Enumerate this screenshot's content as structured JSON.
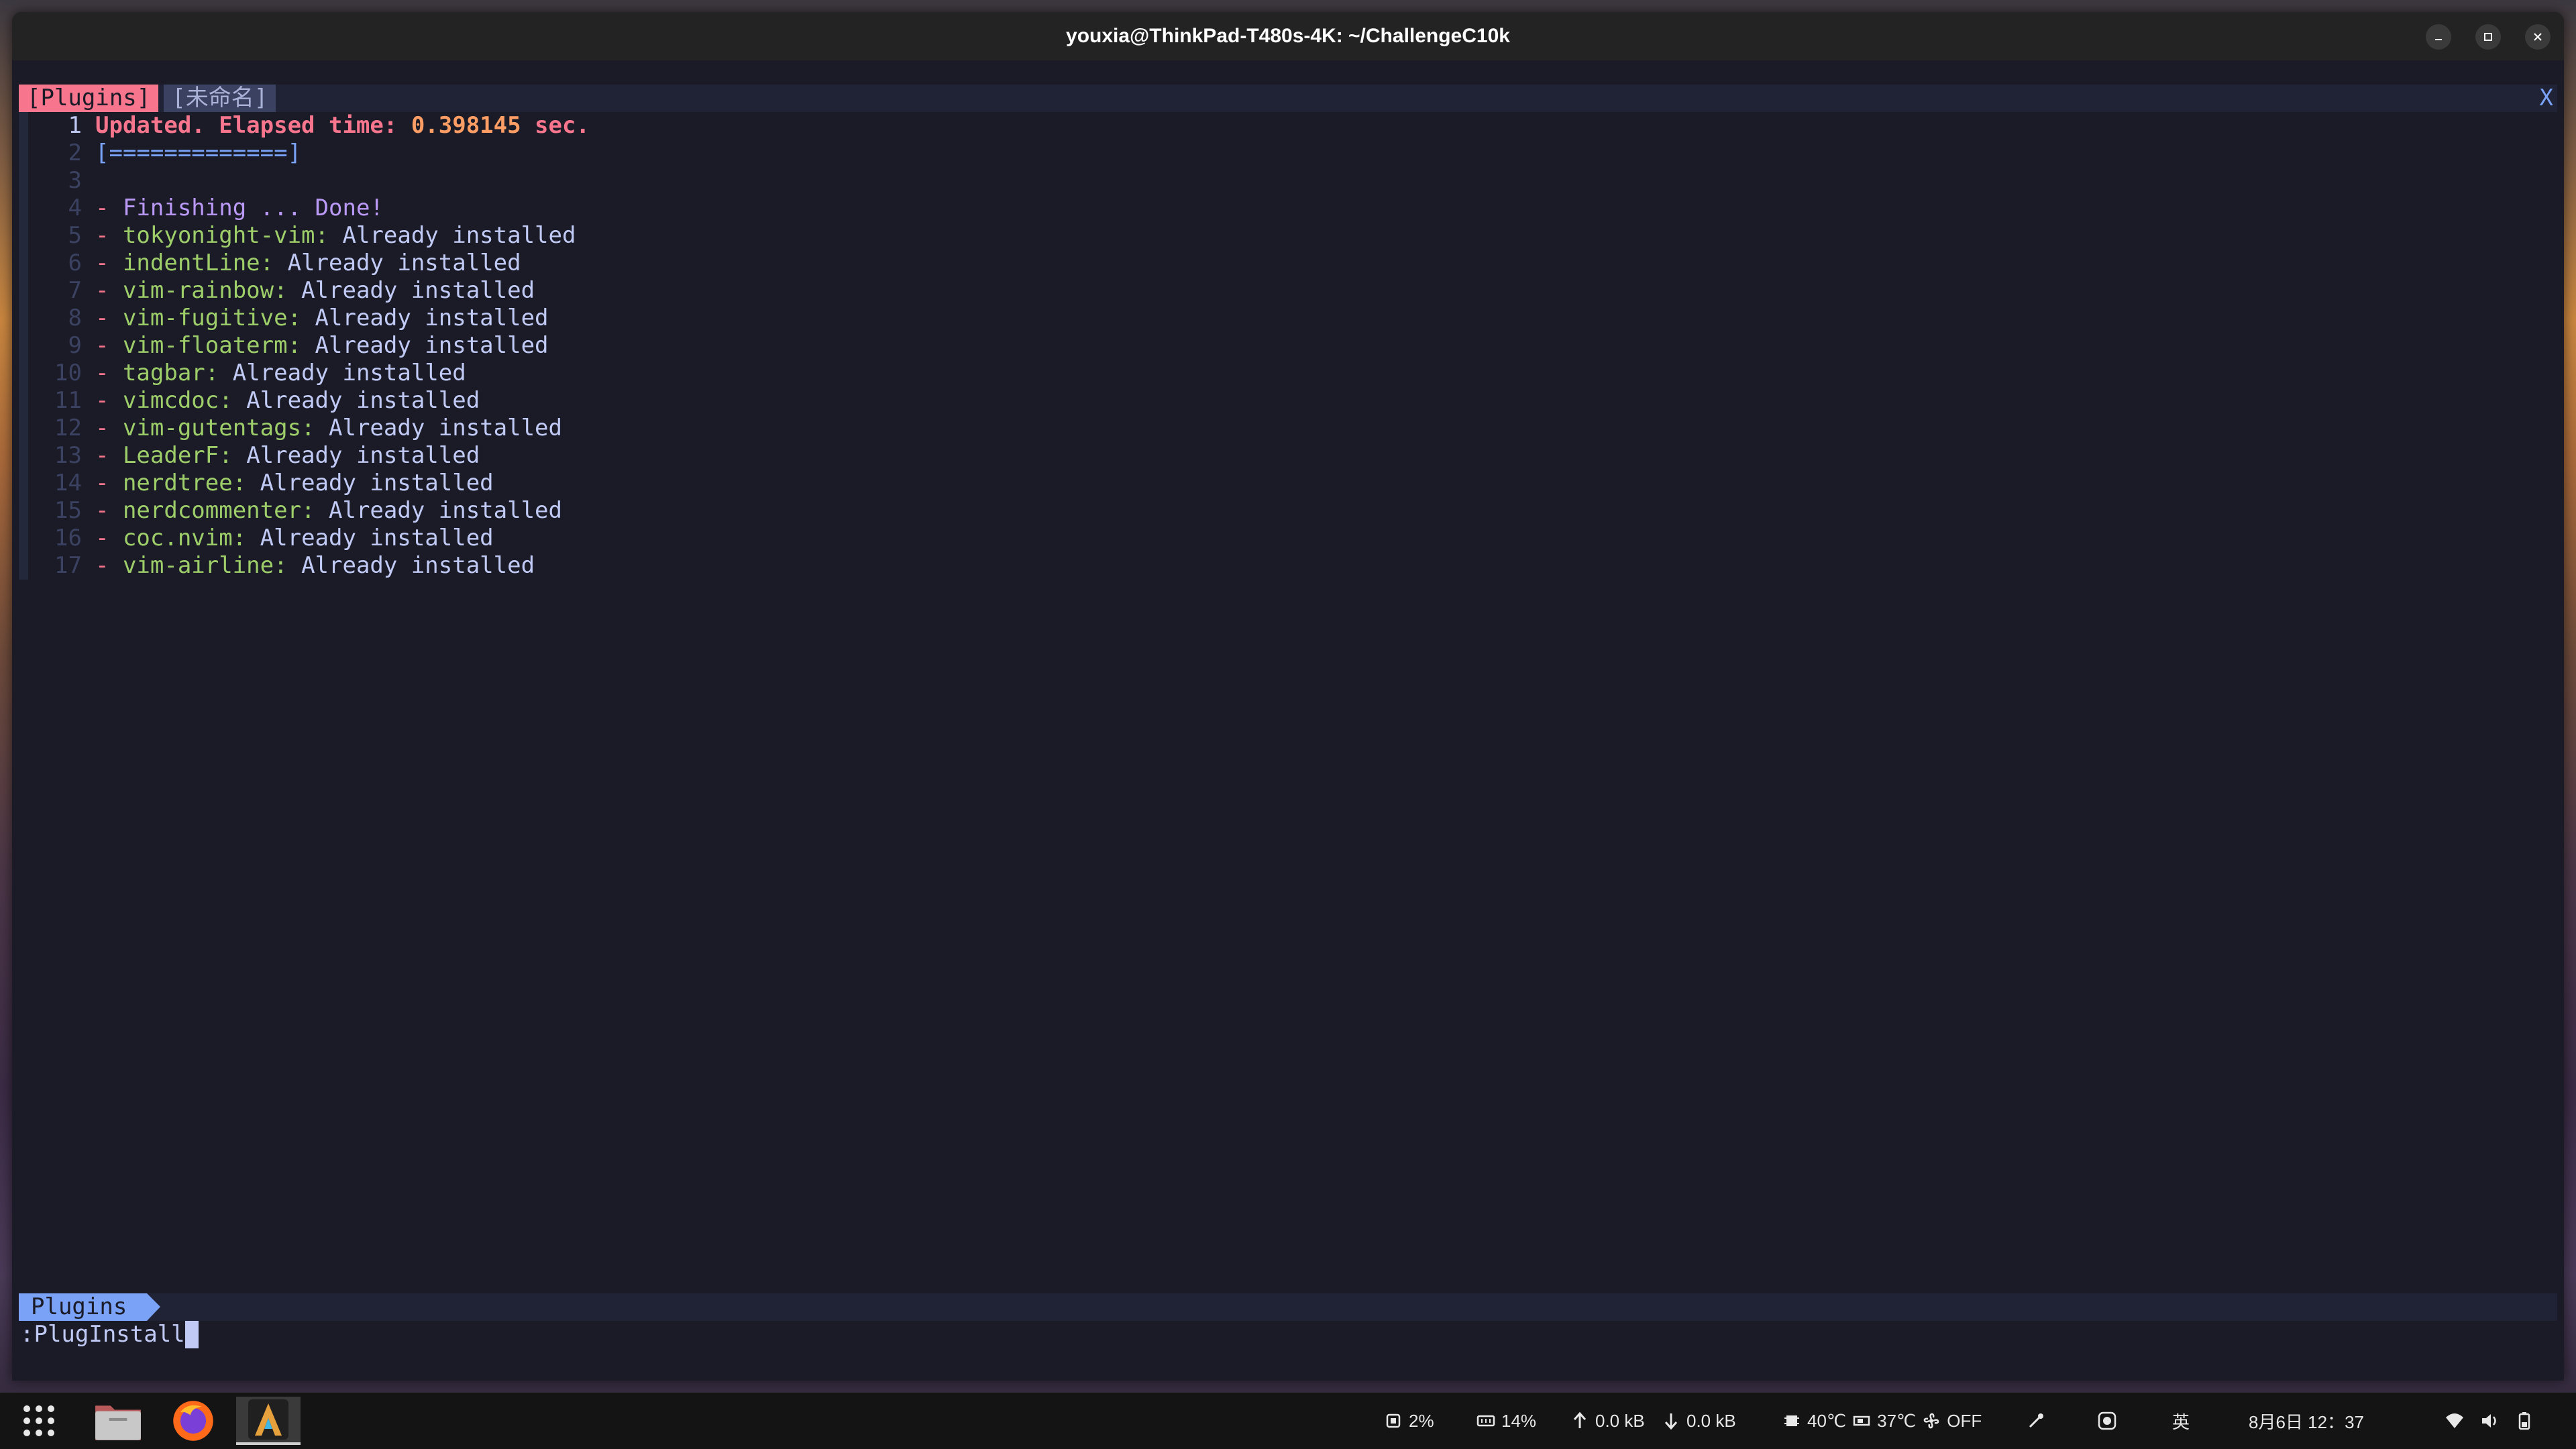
{
  "window": {
    "title": "youxia@ThinkPad-T480s-4K: ~/ChallengeC10k"
  },
  "vim": {
    "tabs": [
      "[Plugins]",
      "[未命名]"
    ],
    "tab_close": "X",
    "lines": [
      {
        "num": "1",
        "parts": [
          {
            "t": "Updated. Elapsed time: ",
            "c": "txt-head"
          },
          {
            "t": "0.398145",
            "c": "txt-time"
          },
          {
            "t": " sec.",
            "c": "txt-head"
          }
        ]
      },
      {
        "num": "2",
        "parts": [
          {
            "t": "[=============]",
            "c": "txt-bar"
          }
        ]
      },
      {
        "num": "3",
        "parts": []
      },
      {
        "num": "4",
        "parts": [
          {
            "t": "- ",
            "c": "dash"
          },
          {
            "t": "Finishing ... Done!",
            "c": "txt-finish"
          }
        ]
      },
      {
        "num": "5",
        "parts": [
          {
            "t": "- ",
            "c": "dash"
          },
          {
            "t": "tokyonight-vim:",
            "c": "pname"
          },
          {
            "t": " Already installed",
            "c": "pstat"
          }
        ]
      },
      {
        "num": "6",
        "parts": [
          {
            "t": "- ",
            "c": "dash"
          },
          {
            "t": "indentLine:",
            "c": "pname"
          },
          {
            "t": " Already installed",
            "c": "pstat"
          }
        ]
      },
      {
        "num": "7",
        "parts": [
          {
            "t": "- ",
            "c": "dash"
          },
          {
            "t": "vim-rainbow:",
            "c": "pname"
          },
          {
            "t": " Already installed",
            "c": "pstat"
          }
        ]
      },
      {
        "num": "8",
        "parts": [
          {
            "t": "- ",
            "c": "dash"
          },
          {
            "t": "vim-fugitive:",
            "c": "pname"
          },
          {
            "t": " Already installed",
            "c": "pstat"
          }
        ]
      },
      {
        "num": "9",
        "parts": [
          {
            "t": "- ",
            "c": "dash"
          },
          {
            "t": "vim-floaterm:",
            "c": "pname"
          },
          {
            "t": " Already installed",
            "c": "pstat"
          }
        ]
      },
      {
        "num": "10",
        "parts": [
          {
            "t": "- ",
            "c": "dash"
          },
          {
            "t": "tagbar:",
            "c": "pname"
          },
          {
            "t": " Already installed",
            "c": "pstat"
          }
        ]
      },
      {
        "num": "11",
        "parts": [
          {
            "t": "- ",
            "c": "dash"
          },
          {
            "t": "vimcdoc:",
            "c": "pname"
          },
          {
            "t": " Already installed",
            "c": "pstat"
          }
        ]
      },
      {
        "num": "12",
        "parts": [
          {
            "t": "- ",
            "c": "dash"
          },
          {
            "t": "vim-gutentags:",
            "c": "pname"
          },
          {
            "t": " Already installed",
            "c": "pstat"
          }
        ]
      },
      {
        "num": "13",
        "parts": [
          {
            "t": "- ",
            "c": "dash"
          },
          {
            "t": "LeaderF:",
            "c": "pname"
          },
          {
            "t": " Already installed",
            "c": "pstat"
          }
        ]
      },
      {
        "num": "14",
        "parts": [
          {
            "t": "- ",
            "c": "dash"
          },
          {
            "t": "nerdtree:",
            "c": "pname"
          },
          {
            "t": " Already installed",
            "c": "pstat"
          }
        ]
      },
      {
        "num": "15",
        "parts": [
          {
            "t": "- ",
            "c": "dash"
          },
          {
            "t": "nerdcommenter:",
            "c": "pname"
          },
          {
            "t": " Already installed",
            "c": "pstat"
          }
        ]
      },
      {
        "num": "16",
        "parts": [
          {
            "t": "- ",
            "c": "dash"
          },
          {
            "t": "coc.nvim:",
            "c": "pname"
          },
          {
            "t": " Already installed",
            "c": "pstat"
          }
        ]
      },
      {
        "num": "17",
        "parts": [
          {
            "t": "- ",
            "c": "dash"
          },
          {
            "t": "vim-airline:",
            "c": "pname"
          },
          {
            "t": " Already installed",
            "c": "pstat"
          }
        ]
      }
    ],
    "status_mode": "Plugins",
    "command": ":PlugInstall"
  },
  "taskbar": {
    "apps": [
      "app-grid-icon",
      "files-icon",
      "firefox-icon",
      "alacritty-icon"
    ],
    "cpu": "2%",
    "mem": "14%",
    "upload": "0.0 kB",
    "download": "0.0 kB",
    "cpu_temp": "40℃",
    "gpu_temp": "37℃",
    "fan": "OFF",
    "ime": "英",
    "clock": "8月6日 12：37"
  },
  "colors": {
    "bg": "#1a1b26",
    "accent_red": "#f7768e",
    "accent_blue": "#7aa2f7",
    "accent_green": "#9ece6a",
    "accent_purple": "#bb9af7",
    "accent_orange": "#ff9e64"
  }
}
